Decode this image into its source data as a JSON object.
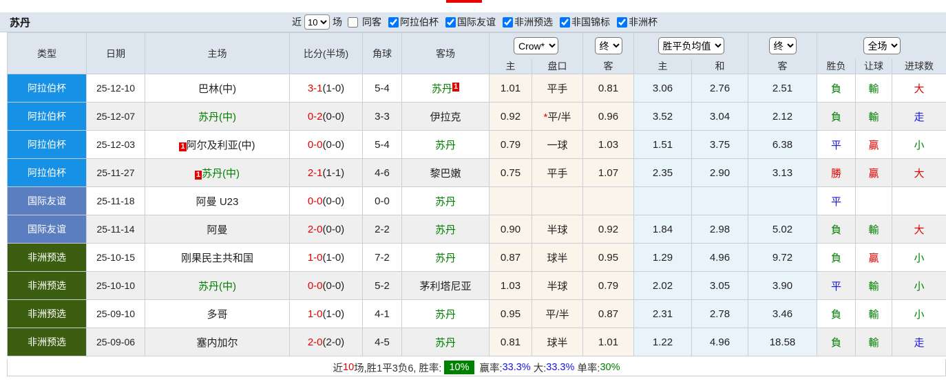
{
  "colors": {
    "accent_red": "#e60000",
    "green": "#008000",
    "blue": "#1515e0",
    "type_blue": "#1791e6",
    "type_slate": "#5b7ec0",
    "type_olive": "#3c5e10",
    "header_bg": "#dde5ee"
  },
  "titlebar": {
    "team": "苏丹",
    "recent_label": "近",
    "recent_value": "10",
    "games_label": "场",
    "same_away": {
      "label": "同客",
      "checked": false
    },
    "filters": [
      {
        "label": "阿拉伯杯",
        "checked": true
      },
      {
        "label": "国际友谊",
        "checked": true
      },
      {
        "label": "非洲预选",
        "checked": true
      },
      {
        "label": "非国锦标",
        "checked": true
      },
      {
        "label": "非洲杯",
        "checked": true
      }
    ]
  },
  "header": {
    "left_cols": [
      "类型",
      "日期",
      "主场",
      "比分(半场)",
      "角球",
      "客场"
    ],
    "selects": {
      "odds_source": "Crow*",
      "odds_time": "终",
      "mean_source": "胜平负均值",
      "mean_time": "终",
      "scope": "全场"
    },
    "sub_cols": [
      "主",
      "盘口",
      "客",
      "主",
      "和",
      "客",
      "胜负",
      "让球",
      "进球数"
    ]
  },
  "rows": [
    {
      "type": "阿拉伯杯",
      "type_style": "blue",
      "date": "25-12-10",
      "home": {
        "name": "巴林(中)",
        "green": false,
        "badge_before": "",
        "badge_after": ""
      },
      "score": "3-1",
      "half": "(1-0)",
      "corner": "5-4",
      "away": {
        "name": "苏丹",
        "green": true,
        "badge_before": "",
        "badge_after": "1"
      },
      "crow": {
        "home": "1.01",
        "handicap": "平手",
        "star": false,
        "away": "0.81"
      },
      "mean": {
        "home": "3.06",
        "draw": "2.76",
        "away": "2.51"
      },
      "result": {
        "wdl": "負",
        "wdl_color": "green",
        "handicap": "輸",
        "handicap_color": "green",
        "goals": "大",
        "goals_color": "red"
      }
    },
    {
      "type": "阿拉伯杯",
      "type_style": "blue",
      "date": "25-12-07",
      "home": {
        "name": "苏丹(中)",
        "green": true,
        "badge_before": "",
        "badge_after": ""
      },
      "score": "0-2",
      "half": "(0-0)",
      "corner": "3-3",
      "away": {
        "name": "伊拉克",
        "green": false,
        "badge_before": "",
        "badge_after": ""
      },
      "crow": {
        "home": "0.92",
        "handicap": "平/半",
        "star": true,
        "away": "0.96"
      },
      "mean": {
        "home": "3.52",
        "draw": "3.04",
        "away": "2.12"
      },
      "result": {
        "wdl": "負",
        "wdl_color": "green",
        "handicap": "輸",
        "handicap_color": "green",
        "goals": "走",
        "goals_color": "blue"
      }
    },
    {
      "type": "阿拉伯杯",
      "type_style": "blue",
      "date": "25-12-03",
      "home": {
        "name": "阿尔及利亚(中)",
        "green": false,
        "badge_before": "1",
        "badge_after": ""
      },
      "score": "0-0",
      "half": "(0-0)",
      "corner": "5-4",
      "away": {
        "name": "苏丹",
        "green": true,
        "badge_before": "",
        "badge_after": ""
      },
      "crow": {
        "home": "0.79",
        "handicap": "一球",
        "star": false,
        "away": "1.03"
      },
      "mean": {
        "home": "1.51",
        "draw": "3.75",
        "away": "6.38"
      },
      "result": {
        "wdl": "平",
        "wdl_color": "blue",
        "handicap": "贏",
        "handicap_color": "red",
        "goals": "小",
        "goals_color": "green"
      }
    },
    {
      "type": "阿拉伯杯",
      "type_style": "blue",
      "date": "25-11-27",
      "home": {
        "name": "苏丹(中)",
        "green": true,
        "badge_before": "1",
        "badge_after": ""
      },
      "score": "2-1",
      "half": "(1-1)",
      "corner": "4-6",
      "away": {
        "name": "黎巴嫩",
        "green": false,
        "badge_before": "",
        "badge_after": ""
      },
      "crow": {
        "home": "0.75",
        "handicap": "平手",
        "star": false,
        "away": "1.07"
      },
      "mean": {
        "home": "2.35",
        "draw": "2.90",
        "away": "3.13"
      },
      "result": {
        "wdl": "勝",
        "wdl_color": "red",
        "handicap": "贏",
        "handicap_color": "red",
        "goals": "大",
        "goals_color": "red"
      }
    },
    {
      "type": "国际友谊",
      "type_style": "slate",
      "date": "25-11-18",
      "home": {
        "name": "阿曼 U23",
        "green": false,
        "badge_before": "",
        "badge_after": ""
      },
      "score": "0-0",
      "half": "(0-0)",
      "corner": "0-0",
      "away": {
        "name": "苏丹",
        "green": true,
        "badge_before": "",
        "badge_after": ""
      },
      "crow": {
        "home": "",
        "handicap": "",
        "star": false,
        "away": ""
      },
      "mean": {
        "home": "",
        "draw": "",
        "away": ""
      },
      "result": {
        "wdl": "平",
        "wdl_color": "blue",
        "handicap": "",
        "handicap_color": "green",
        "goals": "",
        "goals_color": "green"
      }
    },
    {
      "type": "国际友谊",
      "type_style": "slate",
      "date": "25-11-14",
      "home": {
        "name": "阿曼",
        "green": false,
        "badge_before": "",
        "badge_after": ""
      },
      "score": "2-0",
      "half": "(0-0)",
      "corner": "2-2",
      "away": {
        "name": "苏丹",
        "green": true,
        "badge_before": "",
        "badge_after": ""
      },
      "crow": {
        "home": "0.90",
        "handicap": "半球",
        "star": false,
        "away": "0.92"
      },
      "mean": {
        "home": "1.84",
        "draw": "2.98",
        "away": "5.02"
      },
      "result": {
        "wdl": "負",
        "wdl_color": "green",
        "handicap": "輸",
        "handicap_color": "green",
        "goals": "大",
        "goals_color": "red"
      }
    },
    {
      "type": "非洲预选",
      "type_style": "olive",
      "date": "25-10-15",
      "home": {
        "name": "刚果民主共和国",
        "green": false,
        "badge_before": "",
        "badge_after": ""
      },
      "score": "1-0",
      "half": "(1-0)",
      "corner": "7-2",
      "away": {
        "name": "苏丹",
        "green": true,
        "badge_before": "",
        "badge_after": ""
      },
      "crow": {
        "home": "0.87",
        "handicap": "球半",
        "star": false,
        "away": "0.95"
      },
      "mean": {
        "home": "1.29",
        "draw": "4.96",
        "away": "9.72"
      },
      "result": {
        "wdl": "負",
        "wdl_color": "green",
        "handicap": "贏",
        "handicap_color": "red",
        "goals": "小",
        "goals_color": "green"
      }
    },
    {
      "type": "非洲预选",
      "type_style": "olive",
      "date": "25-10-10",
      "home": {
        "name": "苏丹(中)",
        "green": true,
        "badge_before": "",
        "badge_after": ""
      },
      "score": "0-0",
      "half": "(0-0)",
      "corner": "5-2",
      "away": {
        "name": "茅利塔尼亚",
        "green": false,
        "badge_before": "",
        "badge_after": ""
      },
      "crow": {
        "home": "1.03",
        "handicap": "半球",
        "star": false,
        "away": "0.79"
      },
      "mean": {
        "home": "2.02",
        "draw": "3.05",
        "away": "3.90"
      },
      "result": {
        "wdl": "平",
        "wdl_color": "blue",
        "handicap": "輸",
        "handicap_color": "green",
        "goals": "小",
        "goals_color": "green"
      }
    },
    {
      "type": "非洲预选",
      "type_style": "olive",
      "date": "25-09-10",
      "home": {
        "name": "多哥",
        "green": false,
        "badge_before": "",
        "badge_after": ""
      },
      "score": "1-0",
      "half": "(1-0)",
      "corner": "4-1",
      "away": {
        "name": "苏丹",
        "green": true,
        "badge_before": "",
        "badge_after": ""
      },
      "crow": {
        "home": "0.95",
        "handicap": "平/半",
        "star": false,
        "away": "0.87"
      },
      "mean": {
        "home": "2.31",
        "draw": "2.78",
        "away": "3.46"
      },
      "result": {
        "wdl": "負",
        "wdl_color": "green",
        "handicap": "輸",
        "handicap_color": "green",
        "goals": "小",
        "goals_color": "green"
      }
    },
    {
      "type": "非洲预选",
      "type_style": "olive",
      "date": "25-09-06",
      "home": {
        "name": "塞内加尔",
        "green": false,
        "badge_before": "",
        "badge_after": ""
      },
      "score": "2-0",
      "half": "(2-0)",
      "corner": "4-5",
      "away": {
        "name": "苏丹",
        "green": true,
        "badge_before": "",
        "badge_after": ""
      },
      "crow": {
        "home": "0.81",
        "handicap": "球半",
        "star": false,
        "away": "1.01"
      },
      "mean": {
        "home": "1.22",
        "draw": "4.96",
        "away": "18.58"
      },
      "result": {
        "wdl": "負",
        "wdl_color": "green",
        "handicap": "輸",
        "handicap_color": "green",
        "goals": "走",
        "goals_color": "blue"
      }
    }
  ],
  "footer": {
    "t1": "近",
    "count": "10",
    "t2": "场,胜1平3负6, 胜率:",
    "win_rate": "10%",
    "t3": " 赢率:",
    "win_pct": "33.3%",
    "t4": " 大:",
    "big_pct": "33.3%",
    "t5": " 单率:",
    "single_pct": "30%"
  }
}
